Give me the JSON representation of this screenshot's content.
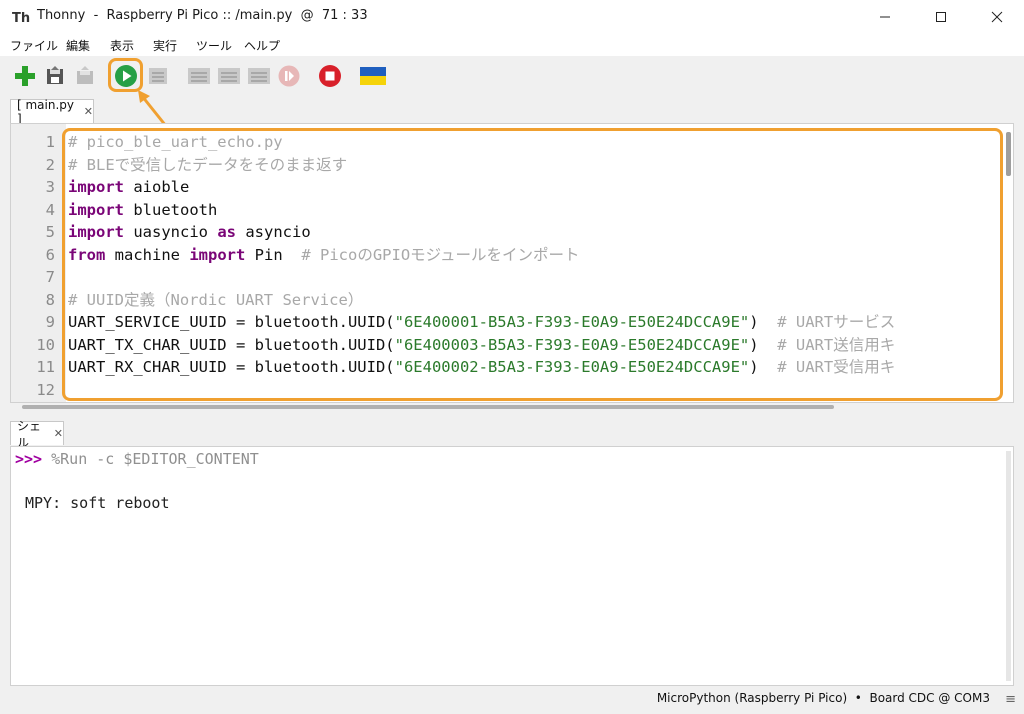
{
  "window": {
    "title": "Thonny  -  Raspberry Pi Pico :: /main.py  @  71 : 33"
  },
  "menu": [
    "ファイル",
    "編集",
    "表示",
    "実行",
    "ツール",
    "ヘルプ"
  ],
  "toolbar": {
    "buttons": [
      "new-file",
      "save",
      "load",
      "run",
      "debug",
      "step-over",
      "step-into",
      "step-out",
      "resume",
      "stop",
      "support-ukraine"
    ]
  },
  "editor": {
    "tab_label": "[ main.py ]",
    "close_glyph": "✕",
    "lines": [
      {
        "n": "1",
        "segs": [
          {
            "t": "# pico_ble_uart_echo.py",
            "c": "cm"
          }
        ]
      },
      {
        "n": "2",
        "segs": [
          {
            "t": "# BLEで受信したデータをそのまま返す",
            "c": "cm"
          }
        ]
      },
      {
        "n": "3",
        "segs": [
          {
            "t": "import",
            "c": "kw"
          },
          {
            "t": " aioble",
            "c": "tx"
          }
        ]
      },
      {
        "n": "4",
        "segs": [
          {
            "t": "import",
            "c": "kw"
          },
          {
            "t": " bluetooth",
            "c": "tx"
          }
        ]
      },
      {
        "n": "5",
        "segs": [
          {
            "t": "import",
            "c": "kw"
          },
          {
            "t": " uasyncio ",
            "c": "tx"
          },
          {
            "t": "as",
            "c": "kw"
          },
          {
            "t": " asyncio",
            "c": "tx"
          }
        ]
      },
      {
        "n": "6",
        "segs": [
          {
            "t": "from",
            "c": "kw"
          },
          {
            "t": " machine ",
            "c": "tx"
          },
          {
            "t": "import",
            "c": "kw"
          },
          {
            "t": " Pin  ",
            "c": "tx"
          },
          {
            "t": "# PicoのGPIOモジュールをインポート",
            "c": "cm"
          }
        ]
      },
      {
        "n": "7",
        "segs": []
      },
      {
        "n": "8",
        "segs": [
          {
            "t": "# UUID定義（Nordic UART Service）",
            "c": "cm"
          }
        ]
      },
      {
        "n": "9",
        "segs": [
          {
            "t": "UART_SERVICE_UUID = bluetooth.UUID(",
            "c": "tx"
          },
          {
            "t": "\"6E400001-B5A3-F393-E0A9-E50E24DCCA9E\"",
            "c": "st"
          },
          {
            "t": ")  ",
            "c": "tx"
          },
          {
            "t": "# UARTサービス",
            "c": "cm"
          }
        ]
      },
      {
        "n": "10",
        "segs": [
          {
            "t": "UART_TX_CHAR_UUID = bluetooth.UUID(",
            "c": "tx"
          },
          {
            "t": "\"6E400003-B5A3-F393-E0A9-E50E24DCCA9E\"",
            "c": "st"
          },
          {
            "t": ")  ",
            "c": "tx"
          },
          {
            "t": "# UART送信用キ",
            "c": "cm"
          }
        ]
      },
      {
        "n": "11",
        "segs": [
          {
            "t": "UART_RX_CHAR_UUID = bluetooth.UUID(",
            "c": "tx"
          },
          {
            "t": "\"6E400002-B5A3-F393-E0A9-E50E24DCCA9E\"",
            "c": "st"
          },
          {
            "t": ")  ",
            "c": "tx"
          },
          {
            "t": "# UART受信用キ",
            "c": "cm"
          }
        ]
      },
      {
        "n": "12",
        "segs": []
      }
    ]
  },
  "shell": {
    "tab_label": "シェル",
    "close_glyph": "✕",
    "prompt": ">>>",
    "command": " %Run -c $EDITOR_CONTENT",
    "output": "MPY: soft reboot"
  },
  "status": {
    "text": "MicroPython (Raspberry Pi Pico)  •  Board CDC @ COM3",
    "grip": "≡"
  },
  "colors": {
    "keyword": "#7a0577",
    "comment": "#a8a8a8",
    "string": "#2b7a2b",
    "highlight": "#f0a030",
    "prompt": "#a000a0"
  }
}
